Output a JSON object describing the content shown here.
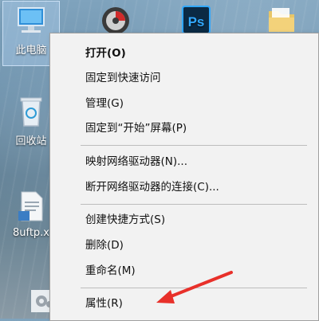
{
  "desktop": {
    "icons": [
      {
        "label": "此电脑",
        "icon": "computer-icon"
      },
      {
        "label": "回收站",
        "icon": "recycle-bin-icon"
      },
      {
        "label": "8uftp.x",
        "icon": "document-icon"
      },
      {
        "label": "",
        "icon": "gear-icon"
      },
      {
        "label": "",
        "icon": "media-player-icon"
      },
      {
        "label": "",
        "icon": "photoshop-icon"
      },
      {
        "label": "",
        "icon": "folder-icon"
      }
    ],
    "ps_text": "Ps"
  },
  "context_menu": {
    "items": [
      {
        "label": "打开(O)",
        "bold": true
      },
      {
        "label": "固定到快速访问"
      },
      {
        "label": "管理(G)"
      },
      {
        "label": "固定到“开始”屏幕(P)"
      },
      {
        "label": "映射网络驱动器(N)..."
      },
      {
        "label": "断开网络驱动器的连接(C)..."
      },
      {
        "label": "创建快捷方式(S)"
      },
      {
        "label": "删除(D)"
      },
      {
        "label": "重命名(M)"
      },
      {
        "label": "属性(R)"
      }
    ]
  },
  "annotation": {
    "arrow_color": "#e8302a",
    "target": "属性(R)"
  }
}
